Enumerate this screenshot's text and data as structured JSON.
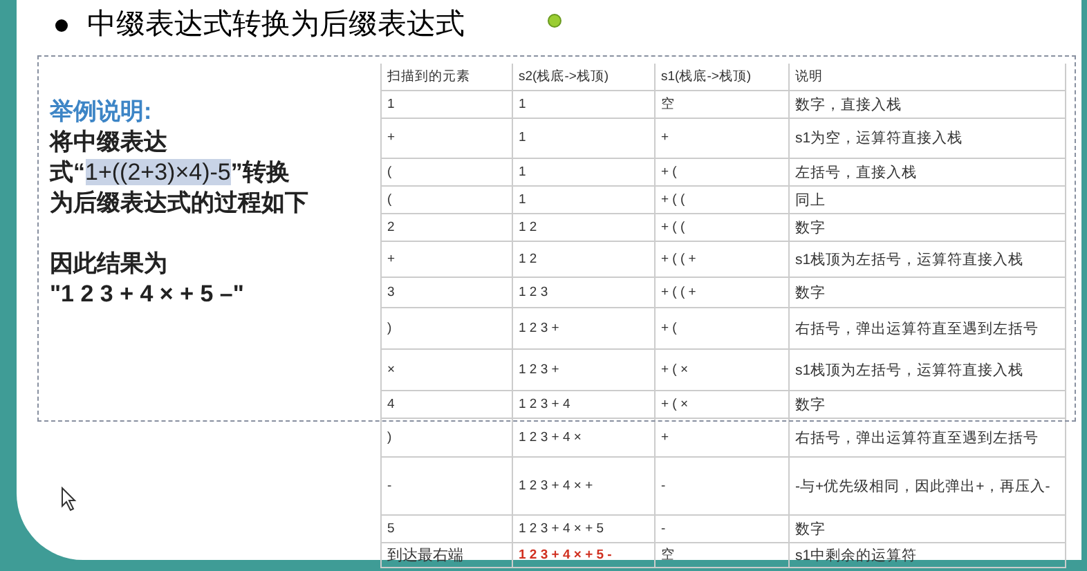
{
  "title": "中缀表达式转换为后缀表达式",
  "example": {
    "heading": "举例说明:",
    "before": "将中缀表达式“",
    "expression": "1+((2+3)×4)-5",
    "expression_selected": true,
    "after": "”转换为后缀表达式的过程如下",
    "result_label": "因此结果为",
    "result": "\"1 2 3 + 4 × + 5 –\""
  },
  "table": {
    "columns": [
      "扫描到的元素",
      "s2(栈底->栈顶)",
      "s1(栈底->栈顶)",
      "说明"
    ],
    "rows": [
      {
        "cells": [
          "1",
          "1",
          "空",
          "数字，直接入栈"
        ],
        "highlighted": false
      },
      {
        "cells": [
          "+",
          "1",
          "+",
          "s1为空，运算符直接入栈"
        ],
        "highlighted": false
      },
      {
        "cells": [
          "(",
          "1",
          "+ (",
          "左括号，直接入栈"
        ],
        "highlighted": false
      },
      {
        "cells": [
          "(",
          "1",
          "+ ( (",
          "同上"
        ],
        "highlighted": false
      },
      {
        "cells": [
          "2",
          "1 2",
          "+ ( (",
          "数字"
        ],
        "highlighted": false
      },
      {
        "cells": [
          "+",
          "1 2",
          "+ ( ( +",
          "s1栈顶为左括号，运算符直接入栈"
        ],
        "highlighted": false
      },
      {
        "cells": [
          "3",
          "1 2 3",
          "+ ( ( +",
          "数字"
        ],
        "highlighted": false
      },
      {
        "cells": [
          ")",
          "1 2 3 +",
          "+ (",
          "右括号，弹出运算符直至遇到左括号"
        ],
        "highlighted": false
      },
      {
        "cells": [
          "×",
          "1 2 3 +",
          "+ ( ×",
          "s1栈顶为左括号，运算符直接入栈"
        ],
        "highlighted": false
      },
      {
        "cells": [
          "4",
          "1 2 3 + 4",
          "+ ( ×",
          "数字"
        ],
        "highlighted": false
      },
      {
        "cells": [
          ")",
          "1 2 3 + 4 ×",
          "+",
          "右括号，弹出运算符直至遇到左括号"
        ],
        "highlighted": false
      },
      {
        "cells": [
          "-",
          "1 2 3 + 4 × +",
          "-",
          "-与+优先级相同，因此弹出+，再压入-"
        ],
        "highlighted": false
      },
      {
        "cells": [
          "5",
          "1 2 3 + 4 × + 5",
          "-",
          "数字"
        ],
        "highlighted": false
      },
      {
        "cells": [
          "到达最右端",
          "1 2 3 + 4 × + 5 -",
          "空",
          "s1中剩余的运算符"
        ],
        "highlighted": true
      }
    ]
  }
}
